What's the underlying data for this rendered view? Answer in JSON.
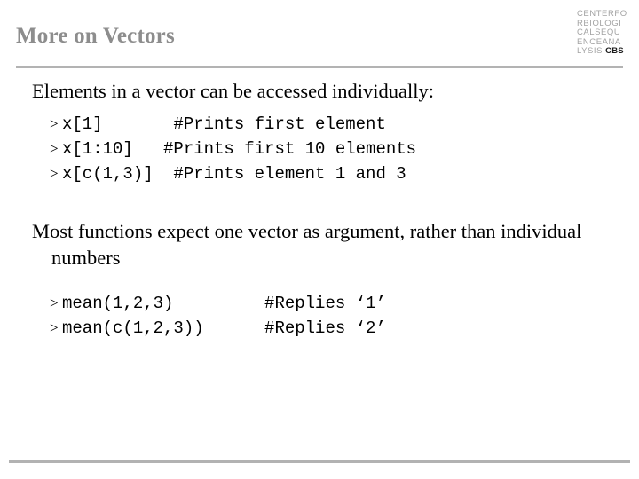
{
  "logo": {
    "lines": [
      "CENTERFO",
      "RBIOLOGI",
      "CALSEQU",
      "ENCEANA"
    ],
    "last_line_prefix": "LYSIS ",
    "last_line_bold": "CBS",
    "color": "#a3a3a3",
    "bold_color": "#1a1a1a"
  },
  "title": {
    "text": "More on Vectors",
    "color": "#8d8d8d"
  },
  "rules": {
    "color": "#b3b3b3"
  },
  "body": {
    "paragraph_1": "Elements in a vector can be accessed individually:",
    "paragraph_2": "Most functions expect one vector as argument, rather than individual numbers",
    "code_block_1": [
      {
        "marker": ">",
        "text": "x[1]       #Prints first element"
      },
      {
        "marker": ">",
        "text": "x[1:10]   #Prints first 10 elements"
      },
      {
        "marker": ">",
        "text": "x[c(1,3)]  #Prints element 1 and 3"
      }
    ],
    "code_block_2": [
      {
        "marker": ">",
        "text": "mean(1,2,3)         #Replies ‘1’"
      },
      {
        "marker": ">",
        "text": "mean(c(1,2,3))      #Replies ‘2’"
      }
    ]
  }
}
